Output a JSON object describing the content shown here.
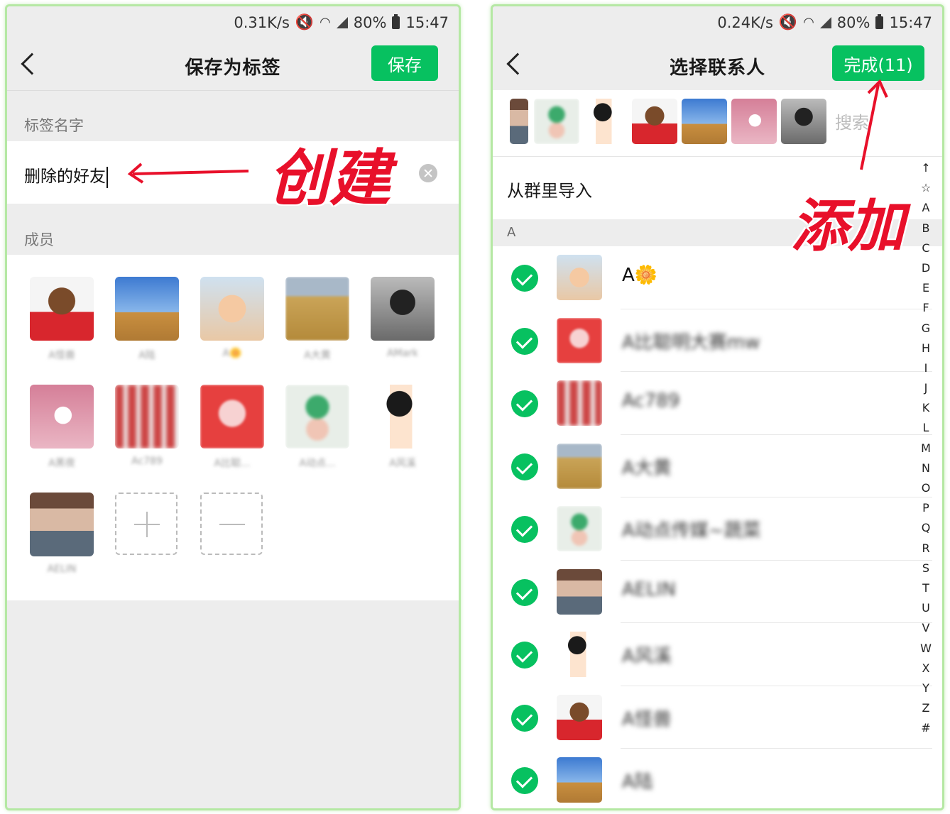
{
  "left": {
    "status": {
      "speed": "0.31K/s",
      "battery": "80%",
      "time": "15:47"
    },
    "nav": {
      "title": "保存为标签",
      "save": "保存"
    },
    "tag_name_label": "标签名字",
    "tag_name_value": "删除的好友",
    "members_label": "成员",
    "annotation": "创建",
    "members": [
      {
        "name": "A怪兽"
      },
      {
        "name": "A陆"
      },
      {
        "name": "A🌼"
      },
      {
        "name": "A大黄"
      },
      {
        "name": "AMark"
      },
      {
        "name": "A黑夜"
      },
      {
        "name": "Ac789"
      },
      {
        "name": "A比聪..."
      },
      {
        "name": "A动点..."
      },
      {
        "name": "A风溪"
      },
      {
        "name": "AELIN"
      }
    ]
  },
  "right": {
    "status": {
      "speed": "0.24K/s",
      "battery": "80%",
      "time": "15:47"
    },
    "nav": {
      "title": "选择联系人",
      "done": "完成(11)"
    },
    "search_placeholder": "搜索",
    "import_label": "从群里导入",
    "section_letter": "A",
    "annotation": "添加",
    "contacts": [
      {
        "name": "A🌼"
      },
      {
        "name": "A比聪明大赛mw"
      },
      {
        "name": "Ac789"
      },
      {
        "name": "A大黄"
      },
      {
        "name": "A动点传媒~蔬菜"
      },
      {
        "name": "AELIN"
      },
      {
        "name": "A风溪"
      },
      {
        "name": "A怪兽"
      },
      {
        "name": "A陆"
      }
    ],
    "index": [
      "↑",
      "☆",
      "A",
      "B",
      "C",
      "D",
      "E",
      "F",
      "G",
      "H",
      "I",
      "J",
      "K",
      "L",
      "M",
      "N",
      "O",
      "P",
      "Q",
      "R",
      "S",
      "T",
      "U",
      "V",
      "W",
      "X",
      "Y",
      "Z",
      "#"
    ]
  },
  "colors": {
    "accent": "#07c160",
    "annotation": "#e8102a",
    "frame": "#b5e8a4"
  }
}
